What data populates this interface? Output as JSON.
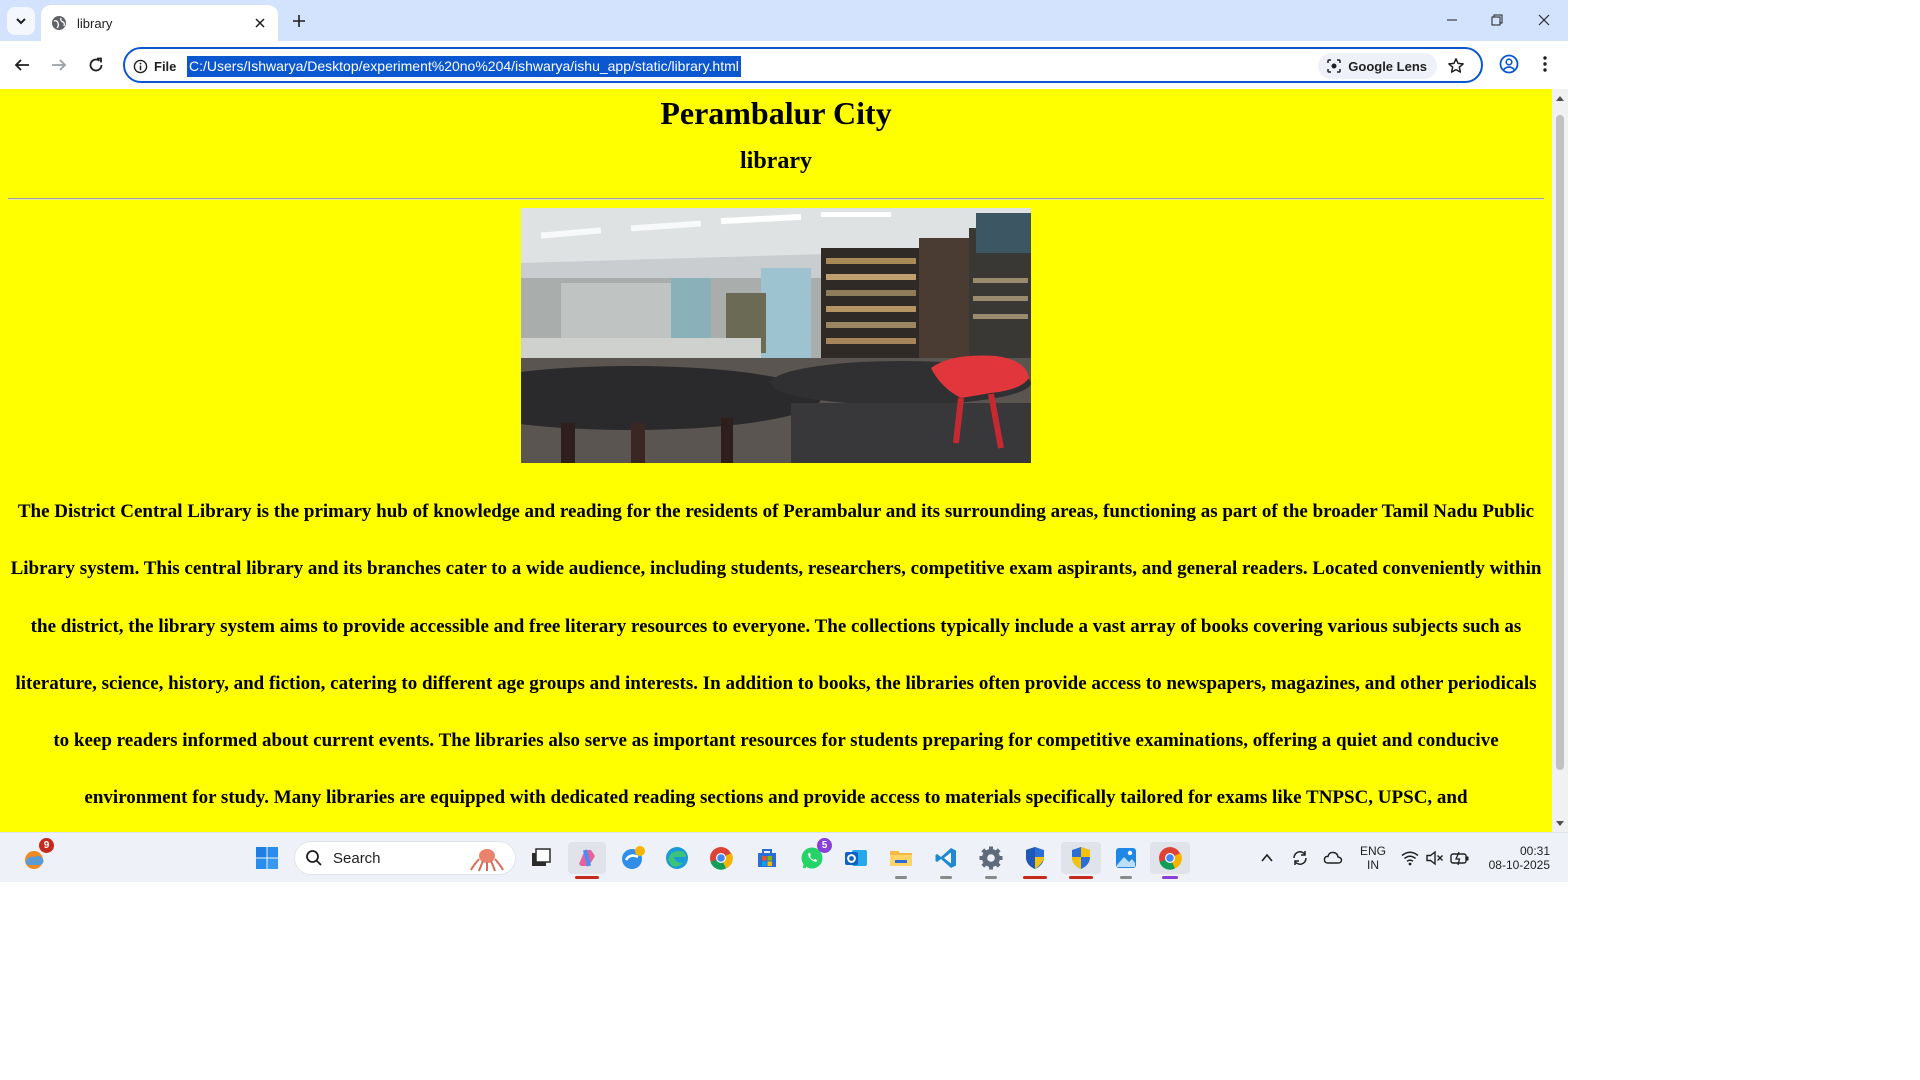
{
  "browser": {
    "tab_title": "library",
    "chip_label": "File",
    "url": "C:/Users/Ishwarya/Desktop/experiment%20no%204/ishwarya/ishu_app/static/library.html",
    "lens_label": "Google Lens"
  },
  "page": {
    "heading": "Perambalur City",
    "subheading": "library",
    "paragraph": "The District Central Library is the primary hub of knowledge and reading for the residents of Perambalur and its surrounding areas, functioning as part of the broader Tamil Nadu Public Library system. This central library and its branches cater to a wide audience, including students, researchers, competitive exam aspirants, and general readers. Located conveniently within the district, the library system aims to provide accessible and free literary resources to everyone. The collections typically include a vast array of books covering various subjects such as literature, science, history, and fiction, catering to different age groups and interests. In addition to books, the libraries often provide access to newspapers, magazines, and other periodicals to keep readers informed about current events. The libraries also serve as important resources for students preparing for competitive examinations, offering a quiet and conducive environment for study. Many libraries are equipped with dedicated reading sections and provide access to materials specifically tailored for exams like TNPSC, UPSC, and"
  },
  "taskbar": {
    "search_placeholder": "Search",
    "weather_badge": "9",
    "whatsapp_badge": "5",
    "language_line1": "ENG",
    "language_line2": "IN",
    "time": "00:31",
    "date": "08-10-2025"
  },
  "colors": {
    "page_background": "#ffff00",
    "tabstrip": "#d3e3fd",
    "accent": "#0b57d0"
  }
}
